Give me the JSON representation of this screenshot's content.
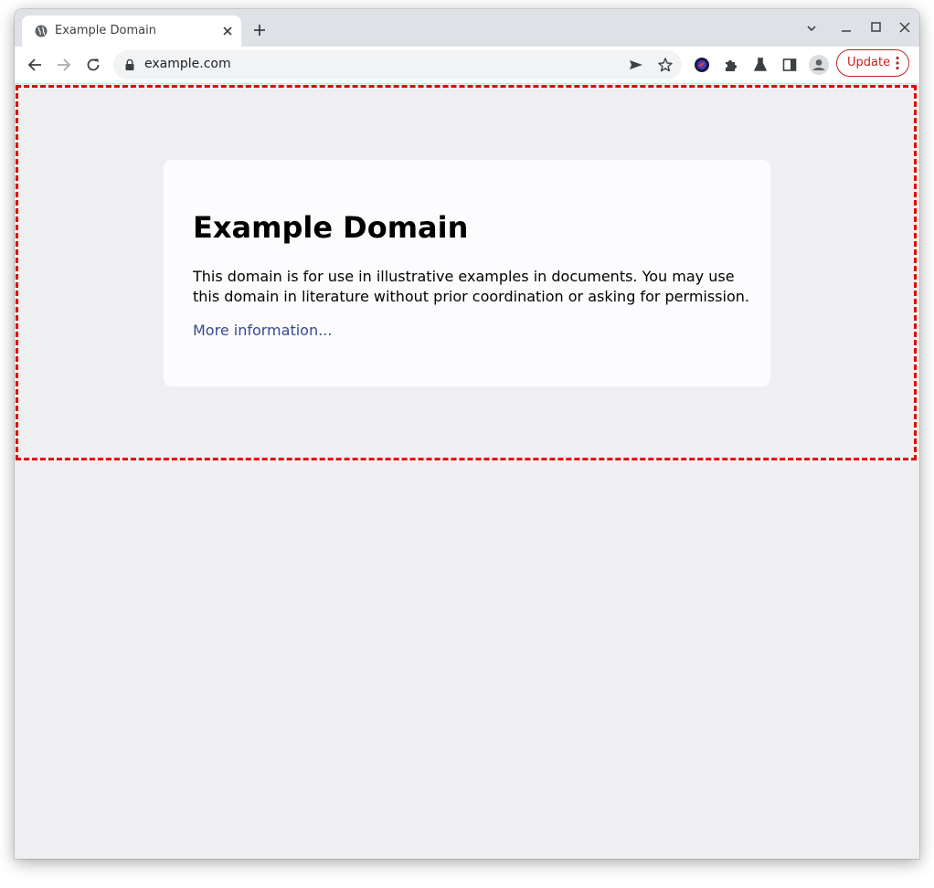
{
  "browser": {
    "tab": {
      "title": "Example Domain"
    },
    "toolbar": {
      "url": "example.com",
      "update_label": "Update"
    }
  },
  "page": {
    "heading": "Example Domain",
    "paragraph": "This domain is for use in illustrative examples in documents. You may use this domain in literature without prior coordination or asking for permission.",
    "link": "More information..."
  },
  "colors": {
    "highlight_border": "#e60000",
    "link": "#38488f",
    "update_accent": "#c5221f",
    "page_background": "#efeff1"
  }
}
